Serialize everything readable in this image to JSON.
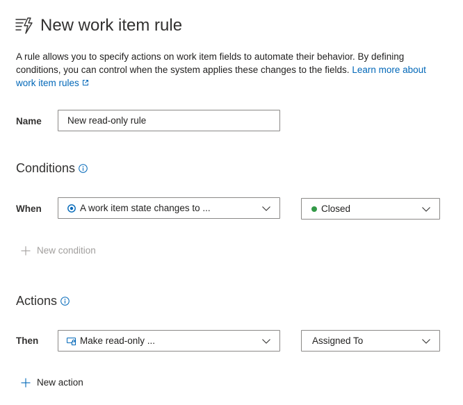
{
  "header": {
    "title": "New work item rule"
  },
  "description": {
    "text": "A rule allows you to specify actions on work item fields to automate their behavior. By defining conditions, you can control when the system applies these changes to the fields.",
    "link_text": "Learn more about work item rules"
  },
  "name_row": {
    "label": "Name",
    "value": "New read-only rule"
  },
  "conditions": {
    "title": "Conditions",
    "when_label": "When",
    "condition_value": "A work item state changes to ...",
    "state_value": "Closed",
    "new_condition_label": "New condition",
    "state_color": "#339947"
  },
  "actions": {
    "title": "Actions",
    "then_label": "Then",
    "action_value": "Make read-only ...",
    "field_value": "Assigned To",
    "new_action_label": "New action"
  },
  "colors": {
    "link": "#0067b8",
    "disabled_text": "#a19f9d",
    "border": "#8a8886"
  }
}
